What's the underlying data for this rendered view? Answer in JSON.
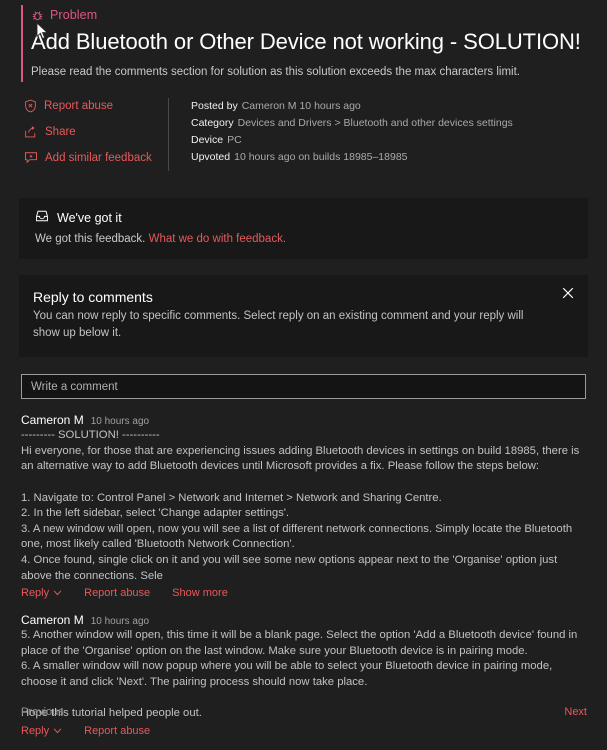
{
  "post": {
    "type_label": "Problem",
    "type_icon": "bug-icon",
    "title": "Add Bluetooth or Other Device not working - SOLUTION!",
    "subtitle": "Please read the comments section for solution as this solution exceeds the max characters limit."
  },
  "actions": [
    {
      "label": "Report abuse",
      "icon": "shield-x-icon"
    },
    {
      "label": "Share",
      "icon": "share-icon"
    },
    {
      "label": "Add similar feedback",
      "icon": "add-comment-icon"
    }
  ],
  "meta": [
    {
      "key": "Posted by",
      "value": "Cameron M 10 hours ago"
    },
    {
      "key": "Category",
      "value": "Devices and Drivers > Bluetooth and other devices settings"
    },
    {
      "key": "Device",
      "value": "PC"
    },
    {
      "key": "Upvoted",
      "value": "10 hours ago  on builds 18985–18985"
    }
  ],
  "got_it": {
    "icon": "inbox-icon",
    "title": "We've got it",
    "body": "We got this feedback.",
    "link": "What we do with feedback."
  },
  "reply_banner": {
    "title": "Reply to comments",
    "body": "You can now reply to specific comments. Select reply on an existing comment and your reply will show up below it.",
    "close_icon": "close-icon"
  },
  "comment_box": {
    "placeholder": "Write a comment",
    "value": ""
  },
  "comments": [
    {
      "author": "Cameron M",
      "time": "10 hours ago",
      "body": "--------- SOLUTION! ----------\nHi everyone, for those that are experiencing issues adding Bluetooth devices in settings on build 18985, there is an alternative way to add Bluetooth devices until Microsoft provides a fix. Please follow the steps below:\n\n1. Navigate to: Control Panel > Network and Internet > Network and Sharing Centre.\n2. In the left sidebar, select 'Change adapter settings'.\n3. A new window will open, now you will see a list of different network connections. Simply locate the Bluetooth one, most likely called 'Bluetooth Network Connection'.\n4. Once found, single click on it and you will see some new options appear next to the 'Organise' option just above the connections. Sele",
      "links": [
        "Reply",
        "Report abuse",
        "Show more"
      ]
    },
    {
      "author": "Cameron M",
      "time": "10 hours ago",
      "body": "5. Another window will open, this time it will be a blank page. Select the option 'Add a Bluetooth device' found in place of the 'Organise' option on the last window. Make sure your Bluetooth device is in pairing mode.\n6. A smaller window will now popup where you will be able to select your Bluetooth device in pairing mode, choose it and click 'Next'. The pairing process should now take place.\n\nHope this tutorial helped people out.",
      "links": [
        "Reply",
        "Report abuse"
      ]
    }
  ],
  "footer": {
    "previous": "Previous",
    "next": "Next"
  },
  "colors": {
    "accent_pink": "#e1548a",
    "link_red": "#e8595a",
    "page_bg": "#1f1f1f",
    "card_bg": "#181818"
  }
}
